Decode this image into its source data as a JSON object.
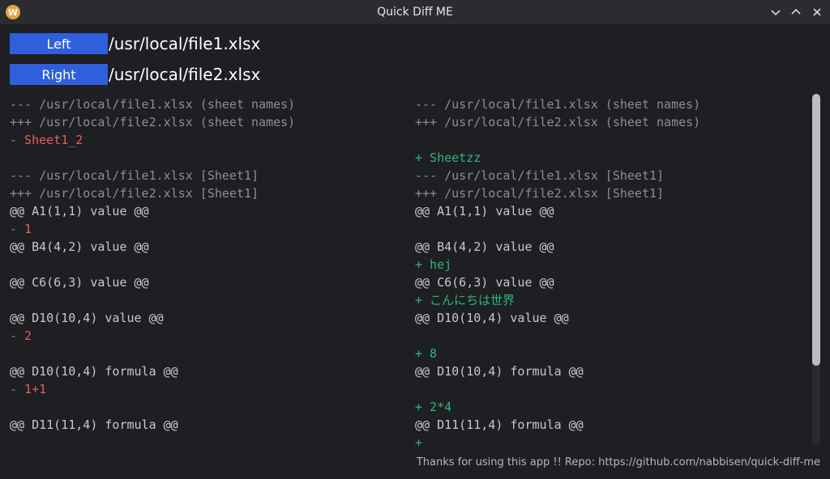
{
  "window": {
    "title": "Quick Diff ME",
    "app_icon_letter": "W"
  },
  "files": {
    "left_label": "Left",
    "left_path": "/usr/local/file1.xlsx",
    "right_label": "Right",
    "right_path": "/usr/local/file2.xlsx"
  },
  "diff": {
    "left": [
      {
        "type": "hdr",
        "text": "--- /usr/local/file1.xlsx (sheet names)"
      },
      {
        "type": "hdr",
        "text": "+++ /usr/local/file2.xlsx (sheet names)"
      },
      {
        "type": "del",
        "text": "- Sheet1_2"
      },
      {
        "type": "blank",
        "text": ""
      },
      {
        "type": "hdr",
        "text": "--- /usr/local/file1.xlsx [Sheet1]"
      },
      {
        "type": "hdr",
        "text": "+++ /usr/local/file2.xlsx [Sheet1]"
      },
      {
        "type": "ctx",
        "text": "@@ A1(1,1) value @@"
      },
      {
        "type": "del",
        "text": "- 1"
      },
      {
        "type": "ctx",
        "text": "@@ B4(4,2) value @@"
      },
      {
        "type": "blank",
        "text": ""
      },
      {
        "type": "ctx",
        "text": "@@ C6(6,3) value @@"
      },
      {
        "type": "blank",
        "text": ""
      },
      {
        "type": "ctx",
        "text": "@@ D10(10,4) value @@"
      },
      {
        "type": "del",
        "text": "- 2"
      },
      {
        "type": "blank",
        "text": ""
      },
      {
        "type": "ctx",
        "text": "@@ D10(10,4) formula @@"
      },
      {
        "type": "del",
        "text": "- 1+1"
      },
      {
        "type": "blank",
        "text": ""
      },
      {
        "type": "ctx",
        "text": "@@ D11(11,4) formula @@"
      },
      {
        "type": "blank",
        "text": ""
      }
    ],
    "right": [
      {
        "type": "hdr",
        "text": "--- /usr/local/file1.xlsx (sheet names)"
      },
      {
        "type": "hdr",
        "text": "+++ /usr/local/file2.xlsx (sheet names)"
      },
      {
        "type": "blank",
        "text": ""
      },
      {
        "type": "add",
        "text": "+ Sheetzz"
      },
      {
        "type": "hdr",
        "text": "--- /usr/local/file1.xlsx [Sheet1]"
      },
      {
        "type": "hdr",
        "text": "+++ /usr/local/file2.xlsx [Sheet1]"
      },
      {
        "type": "ctx",
        "text": "@@ A1(1,1) value @@"
      },
      {
        "type": "blank",
        "text": ""
      },
      {
        "type": "ctx",
        "text": "@@ B4(4,2) value @@"
      },
      {
        "type": "add",
        "text": "+ hej"
      },
      {
        "type": "ctx",
        "text": "@@ C6(6,3) value @@"
      },
      {
        "type": "add",
        "text": "+ こんにちは世界"
      },
      {
        "type": "ctx",
        "text": "@@ D10(10,4) value @@"
      },
      {
        "type": "blank",
        "text": ""
      },
      {
        "type": "add",
        "text": "+ 8"
      },
      {
        "type": "ctx",
        "text": "@@ D10(10,4) formula @@"
      },
      {
        "type": "blank",
        "text": ""
      },
      {
        "type": "add",
        "text": "+ 2*4"
      },
      {
        "type": "ctx",
        "text": "@@ D11(11,4) formula @@"
      },
      {
        "type": "add",
        "text": "+"
      }
    ]
  },
  "footer": {
    "text": "Thanks for using this app !! Repo: https://github.com/nabbisen/quick-diff-me"
  },
  "colors": {
    "accent": "#2f5fdc",
    "deleted": "#e06060",
    "added": "#2eb67d",
    "header": "#8e8e8e"
  }
}
